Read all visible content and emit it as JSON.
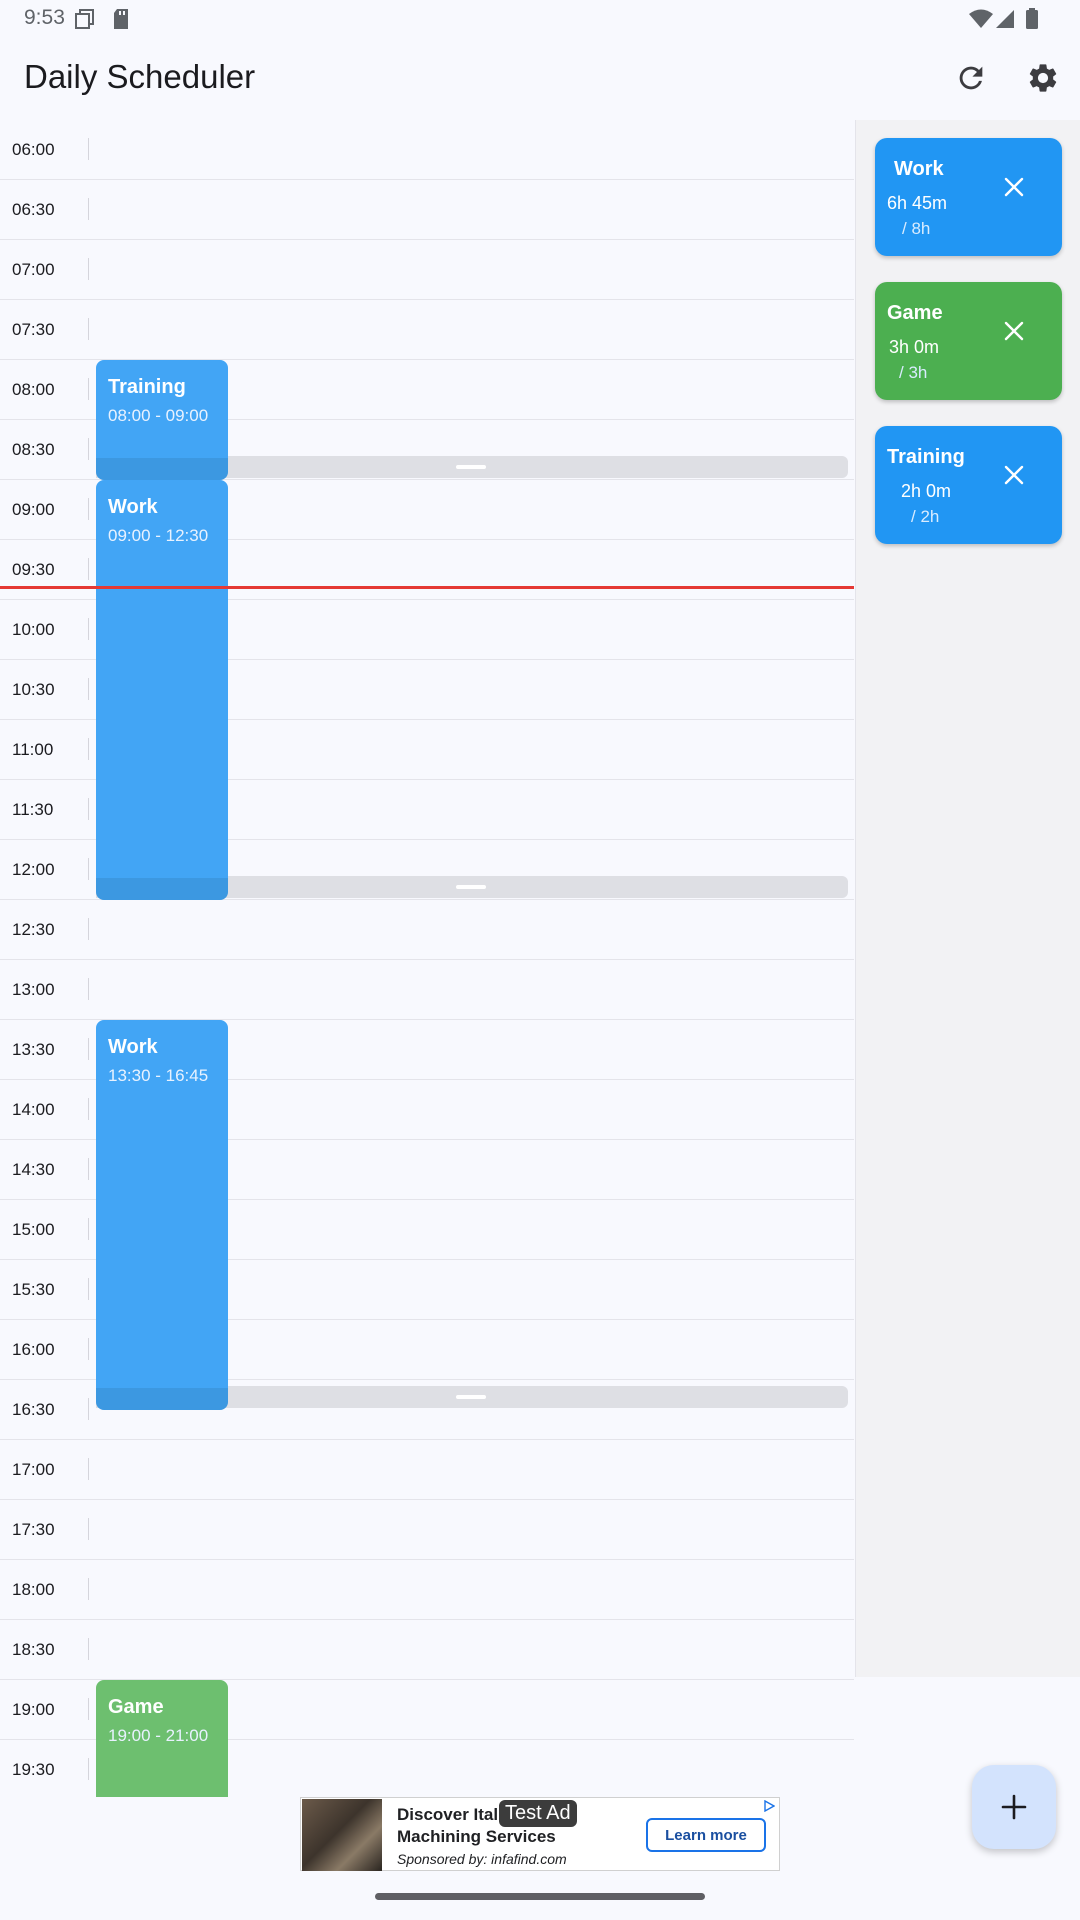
{
  "status_bar": {
    "time": "9:53"
  },
  "app_bar": {
    "title": "Daily Scheduler",
    "refresh_icon": "refresh-icon",
    "settings_icon": "gear-icon"
  },
  "timeline": {
    "slots": [
      "06:00",
      "06:30",
      "07:00",
      "07:30",
      "08:00",
      "08:30",
      "09:00",
      "09:30",
      "10:00",
      "10:30",
      "11:00",
      "11:30",
      "12:00",
      "12:30",
      "13:00",
      "13:30",
      "14:00",
      "14:30",
      "15:00",
      "15:30",
      "16:00",
      "16:30",
      "17:00",
      "17:30",
      "18:00",
      "18:30",
      "19:00",
      "19:30"
    ],
    "current_time_indicator": "09:45",
    "events": [
      {
        "title": "Training",
        "time": "08:00 - 09:00",
        "start": "08:00",
        "end": "09:00",
        "color": "#42a5f5"
      },
      {
        "title": "Work",
        "time": "09:00 - 12:30",
        "start": "09:00",
        "end": "12:30",
        "color": "#42a5f5"
      },
      {
        "title": "Work",
        "time": "13:30 - 16:45",
        "start": "13:30",
        "end": "16:45",
        "color": "#42a5f5"
      },
      {
        "title": "Game",
        "time": "19:00 - 21:00",
        "start": "19:00",
        "end": "21:00",
        "color": "#6dbf6f"
      }
    ]
  },
  "summary": {
    "cards": [
      {
        "title": "Work",
        "used": "6h 45m",
        "target": "/ 8h",
        "color": "#2196f3"
      },
      {
        "title": "Game",
        "used": "3h 0m",
        "target": "/ 3h",
        "color": "#4caf50"
      },
      {
        "title": "Training",
        "used": "2h 0m",
        "target": "/ 2h",
        "color": "#2196f3"
      }
    ]
  },
  "fab": {
    "icon": "plus-icon"
  },
  "ad": {
    "headline": "Discover Ital",
    "headline_line2": "Machining Services",
    "test_label": "Test Ad",
    "sponsor": "Sponsored by: infafind.com",
    "cta": "Learn more"
  }
}
